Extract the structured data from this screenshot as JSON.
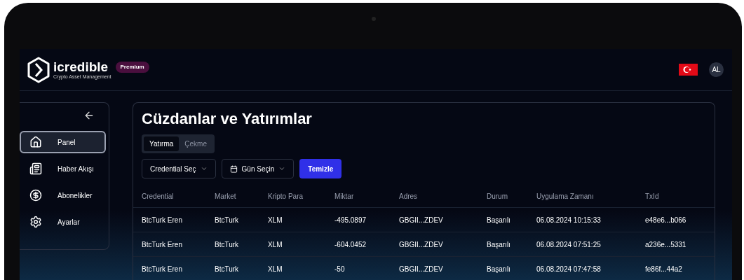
{
  "header": {
    "logo": {
      "name": "icredible",
      "tagline": "Crypto Asset Management"
    },
    "plan_badge": "Premium",
    "avatar": "AL"
  },
  "sidebar": {
    "items": [
      {
        "label": "Panel",
        "selected": true
      },
      {
        "label": "Haber Akışı",
        "selected": false
      },
      {
        "label": "Abonelikler",
        "selected": false
      },
      {
        "label": "Ayarlar",
        "selected": false
      }
    ]
  },
  "page": {
    "title": "Cüzdanlar ve Yatırımlar",
    "tabs": [
      {
        "label": "Yatırma",
        "selected": true
      },
      {
        "label": "Çekme",
        "selected": false
      }
    ],
    "filters": [
      "Credential Seç",
      "Gün Seçin"
    ],
    "clear_button": "Temizle",
    "table": {
      "columns": [
        "Credential",
        "Market",
        "Kripto Para",
        "Miktar",
        "Adres",
        "Durum",
        "Uygulama Zamanı",
        "TxId"
      ],
      "rows": [
        [
          "BtcTurk Eren",
          "BtcTurk",
          "XLM",
          "-495.0897",
          "GBGII...ZDEV",
          "Başarılı",
          "06.08.2024 10:15:33",
          "e48e6...b066"
        ],
        [
          "BtcTurk Eren",
          "BtcTurk",
          "XLM",
          "-604.0452",
          "GBGII...ZDEV",
          "Başarılı",
          "06.08.2024 07:51:25",
          "a236e...5331"
        ],
        [
          "BtcTurk Eren",
          "BtcTurk",
          "XLM",
          "-50",
          "GBGII...ZDEV",
          "Başarılı",
          "06.08.2024 07:47:58",
          "fe86f...44a2"
        ]
      ]
    }
  }
}
